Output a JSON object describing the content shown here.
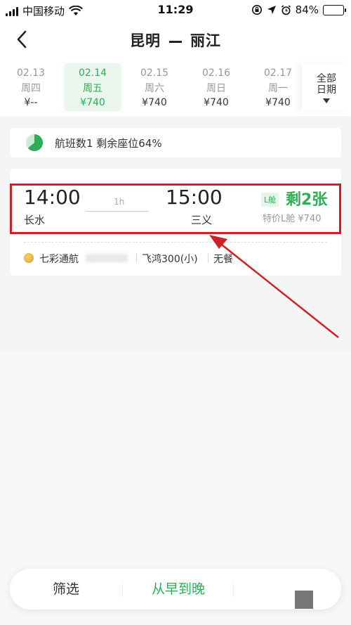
{
  "status_bar": {
    "carrier": "中国移动",
    "time": "11:29",
    "battery": "84%",
    "battery_level": 0.84
  },
  "header": {
    "from": "昆明",
    "to": "丽江"
  },
  "dates": [
    {
      "date": "02.13",
      "weekday": "周四",
      "price": "¥--",
      "active": false
    },
    {
      "date": "02.14",
      "weekday": "周五",
      "price": "¥740",
      "active": true
    },
    {
      "date": "02.15",
      "weekday": "周六",
      "price": "¥740",
      "active": false
    },
    {
      "date": "02.16",
      "weekday": "周日",
      "price": "¥740",
      "active": false
    },
    {
      "date": "02.17",
      "weekday": "周一",
      "price": "¥740",
      "active": false
    }
  ],
  "all_dates": {
    "line1": "全部",
    "line2": "日期"
  },
  "summary": {
    "text": "航班数1 剩余座位64%",
    "remaining_fraction": 0.64
  },
  "flight": {
    "dep_time": "14:00",
    "dep_airport": "长水",
    "duration": "1h",
    "arr_time": "15:00",
    "arr_airport": "三义",
    "cabin_badge": "L舱",
    "seats_left": "剩2张",
    "fare": "特价L舱 ¥740",
    "airline": "七彩通航",
    "aircraft": "飞鸿300(小)",
    "meal": "无餐"
  },
  "bottom_bar": {
    "filter": "筛选",
    "sort": "从早到晚"
  },
  "colors": {
    "accent": "#2fae57",
    "highlight": "#d21f25"
  }
}
